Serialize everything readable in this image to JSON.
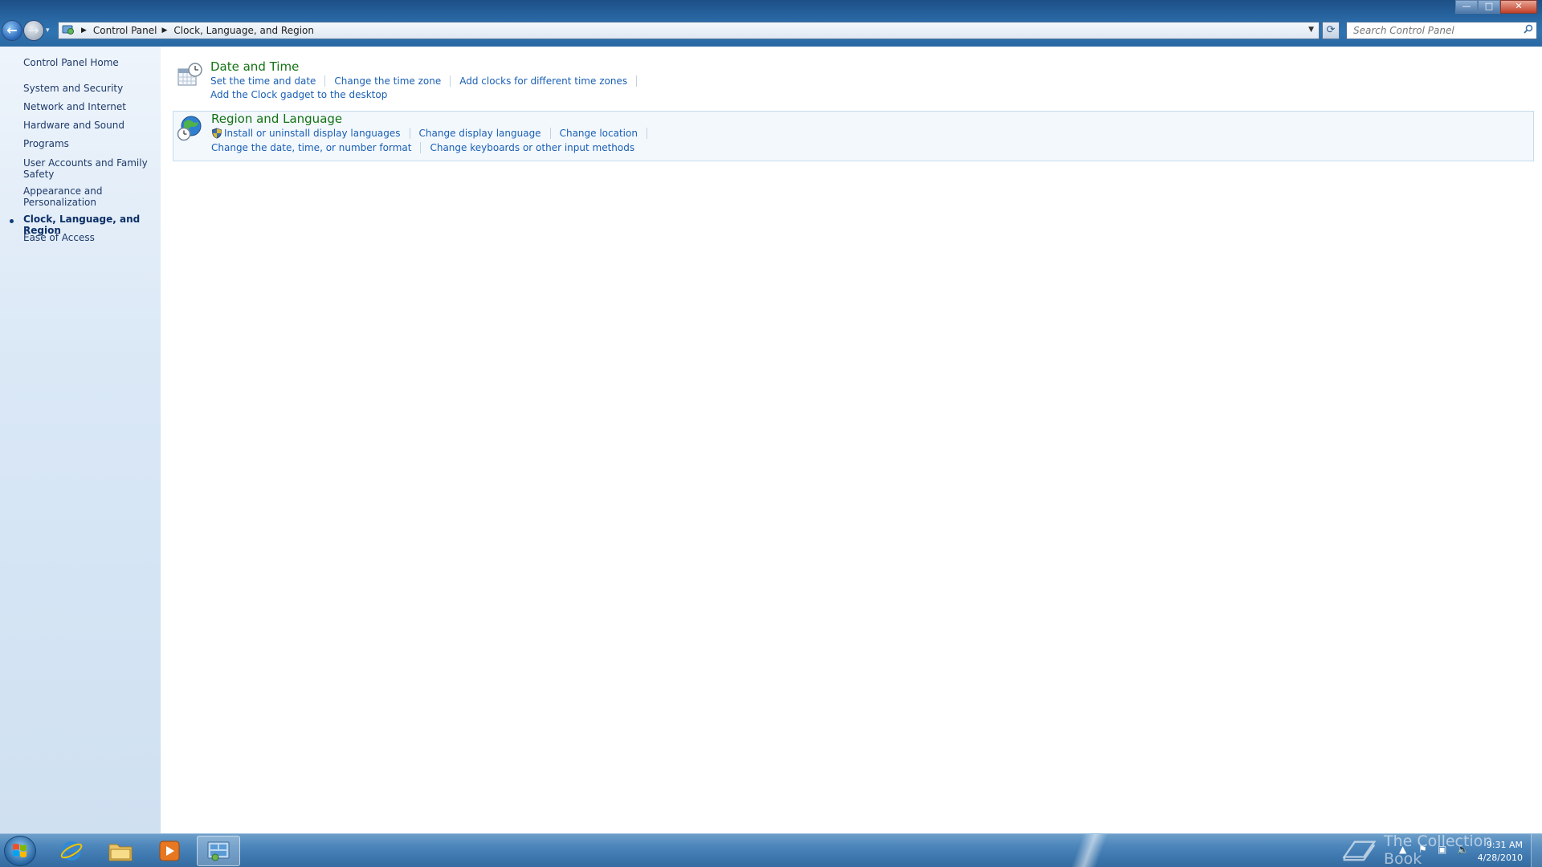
{
  "window": {
    "minimize_glyph": "—",
    "maximize_glyph": "□",
    "close_glyph": "✕"
  },
  "navigation": {
    "back_glyph": "←",
    "forward_glyph": "→",
    "recent_glyph": "▾",
    "breadcrumb": [
      "Control Panel",
      "Clock, Language, and Region"
    ],
    "search_placeholder": "Search Control Panel"
  },
  "sidebar": {
    "home": "Control Panel Home",
    "items": [
      {
        "label": "System and Security"
      },
      {
        "label": "Network and Internet"
      },
      {
        "label": "Hardware and Sound"
      },
      {
        "label": "Programs"
      },
      {
        "label": "User Accounts and Family Safety"
      },
      {
        "label": "Appearance and Personalization"
      },
      {
        "label": "Clock, Language, and Region",
        "active": true
      },
      {
        "label": "Ease of Access"
      }
    ]
  },
  "categories": [
    {
      "title": "Date and Time",
      "icon": "clock-calendar-icon",
      "rows": [
        [
          "Set the time and date",
          "Change the time zone",
          "Add clocks for different time zones"
        ],
        [
          "Add the Clock gadget to the desktop"
        ]
      ]
    },
    {
      "title": "Region and Language",
      "icon": "globe-clock-icon",
      "rows": [
        [
          "Install or uninstall display languages",
          "Change display language",
          "Change location"
        ],
        [
          "Change the date, time, or number format",
          "Change keyboards or other input methods"
        ]
      ]
    }
  ],
  "taskbar": {
    "apps": [
      "internet-explorer-icon",
      "windows-explorer-icon",
      "media-player-icon",
      "control-panel-icon"
    ],
    "clock_time": "9:31 AM",
    "clock_date": "4/28/2010",
    "watermark": "The Collection Book"
  },
  "colors": {
    "link": "#1a5fb4",
    "category_title": "#137213",
    "sidebar_text": "#1e3a6a",
    "titlebar": "#2a6aa6"
  }
}
